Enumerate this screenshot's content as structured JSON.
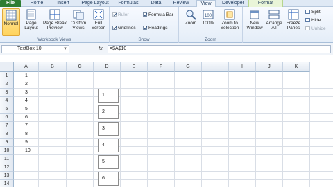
{
  "tabs": [
    {
      "label": "File"
    },
    {
      "label": "Home"
    },
    {
      "label": "Insert"
    },
    {
      "label": "Page Layout"
    },
    {
      "label": "Formulas"
    },
    {
      "label": "Data"
    },
    {
      "label": "Review"
    },
    {
      "label": "View"
    },
    {
      "label": "Developer"
    },
    {
      "label": "Format"
    }
  ],
  "ribbon": {
    "workbook_views": {
      "label": "Workbook Views",
      "normal": "Normal",
      "page_layout": "Page Layout",
      "page_break": "Page Break Preview",
      "custom_views": "Custom Views",
      "full_screen": "Full Screen"
    },
    "show": {
      "label": "Show",
      "ruler": "Ruler",
      "formula_bar": "Formula Bar",
      "gridlines": "Gridlines",
      "headings": "Headings"
    },
    "zoom": {
      "label": "Zoom",
      "zoom": "Zoom",
      "hundred": "100%",
      "selection": "Zoom to Selection"
    },
    "window": {
      "new_window": "New Window",
      "arrange_all": "Arrange All",
      "freeze_panes": "Freeze Panes",
      "split": "Split",
      "hide": "Hide",
      "unhide": "Unhide"
    }
  },
  "formula_bar": {
    "name_box": "TextBox 10",
    "fx": "fx",
    "formula": "=$A$10"
  },
  "grid": {
    "columns": [
      "A",
      "B",
      "C",
      "D",
      "E",
      "F",
      "G",
      "H",
      "I",
      "J",
      "K"
    ],
    "rows": [
      "1",
      "2",
      "3",
      "4",
      "5",
      "6",
      "7",
      "8",
      "9",
      "10",
      "11",
      "12",
      "13",
      "14"
    ],
    "col_a_values": [
      "1",
      "2",
      "3",
      "4",
      "5",
      "6",
      "7",
      "8",
      "9",
      "10"
    ],
    "textboxes": [
      "1",
      "2",
      "3",
      "4",
      "5",
      "6"
    ]
  }
}
